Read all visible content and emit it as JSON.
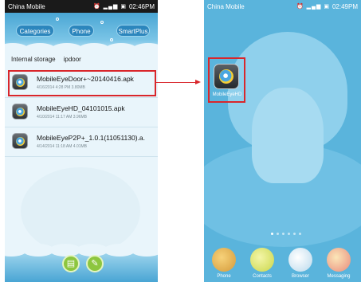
{
  "left_screen": {
    "status": {
      "carrier": "China Mobile",
      "icons": "⏰ ▂▄▆ ▣",
      "time": "02:46PM"
    },
    "tabs": [
      "Categories",
      "Phone",
      "SmartPlus"
    ],
    "breadcrumb": [
      "Internal storage",
      "ipdoor"
    ],
    "files": [
      {
        "name": "MobileEyeDoor+~20140416.apk",
        "meta": "4/16/2014 4:28 PM   3.80MB"
      },
      {
        "name": "MobileEyeHD_04101015.apk",
        "meta": "4/10/2014 11:17 AM   3.96MB"
      },
      {
        "name": "MobileEyeP2P+_1.0.1(11051130).a.",
        "meta": "4/14/2014 11:18 AM   4.01MB"
      }
    ],
    "bottom_buttons": [
      "chat-icon",
      "tools-icon"
    ]
  },
  "right_screen": {
    "status": {
      "carrier": "China Mobile",
      "icons": "⏰ ▂▄▆ ▣",
      "time": "02:49PM"
    },
    "home_app_label": "MobileEyeHD",
    "dock": [
      "Phone",
      "Contacts",
      "Browser",
      "Messaging"
    ]
  },
  "colors": {
    "highlight": "#d9262b",
    "sky": "#5ab4dc",
    "accent_green": "#8dc63f"
  }
}
